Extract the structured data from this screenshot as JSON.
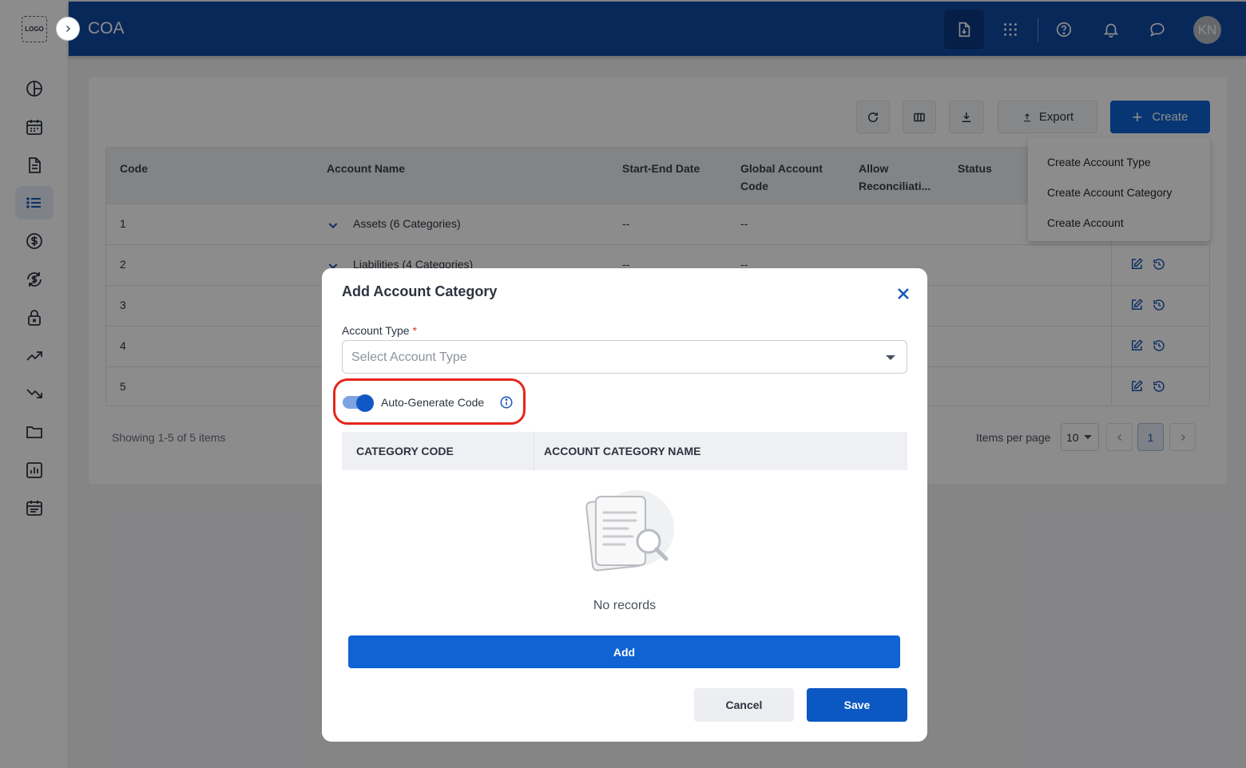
{
  "app": {
    "title": "COA",
    "logo_text": "LOGO",
    "avatar_initials": "KN"
  },
  "sidebar": {
    "items": [
      {
        "icon": "pie-chart-icon"
      },
      {
        "icon": "calendar-icon"
      },
      {
        "icon": "document-icon"
      },
      {
        "icon": "list-icon",
        "active": true
      },
      {
        "icon": "dollar-icon"
      },
      {
        "icon": "dollar-exchange-icon"
      },
      {
        "icon": "lock-icon"
      },
      {
        "icon": "trending-up-icon"
      },
      {
        "icon": "trending-down-icon"
      },
      {
        "icon": "folder-icon"
      },
      {
        "icon": "bar-report-icon"
      },
      {
        "icon": "schedule-icon"
      }
    ]
  },
  "header": {
    "icons": [
      "document-download-icon",
      "apps-grid-icon",
      "help-icon",
      "bell-icon",
      "chat-icon"
    ]
  },
  "toolbar": {
    "export_label": "Export",
    "create_label": "Create"
  },
  "create_menu": {
    "items": [
      "Create Account Type",
      "Create Account Category",
      "Create Account"
    ]
  },
  "table": {
    "columns": [
      "Code",
      "Account Name",
      "Start-End Date",
      "Global Account",
      "Code",
      "Allow",
      "Reconciliati...",
      "Status"
    ],
    "rows": [
      {
        "code": "1",
        "name": "Assets (6 Categories)",
        "dates": "--",
        "global": "--"
      },
      {
        "code": "2",
        "name": "Liabilities (4 Categories)",
        "dates": "--",
        "global": "--"
      },
      {
        "code": "3"
      },
      {
        "code": "4"
      },
      {
        "code": "5"
      }
    ]
  },
  "pagination": {
    "showing": "Showing 1-5 of 5 items",
    "items_per_page_label": "Items per page",
    "items_per_page": "10",
    "current_page": "1"
  },
  "modal": {
    "title": "Add Account Category",
    "account_type_label": "Account Type",
    "required_mark": "*",
    "account_type_placeholder": "Select Account Type",
    "auto_generate_label": "Auto-Generate Code",
    "auto_generate_on": true,
    "col_category_code": "CATEGORY CODE",
    "col_category_name": "ACCOUNT CATEGORY NAME",
    "empty_text": "No records",
    "add_label": "Add",
    "cancel_label": "Cancel",
    "save_label": "Save"
  },
  "colors": {
    "brand_blue": "#0f4aa5",
    "primary_button": "#0f63d3",
    "highlight_ring": "#e5261c"
  }
}
